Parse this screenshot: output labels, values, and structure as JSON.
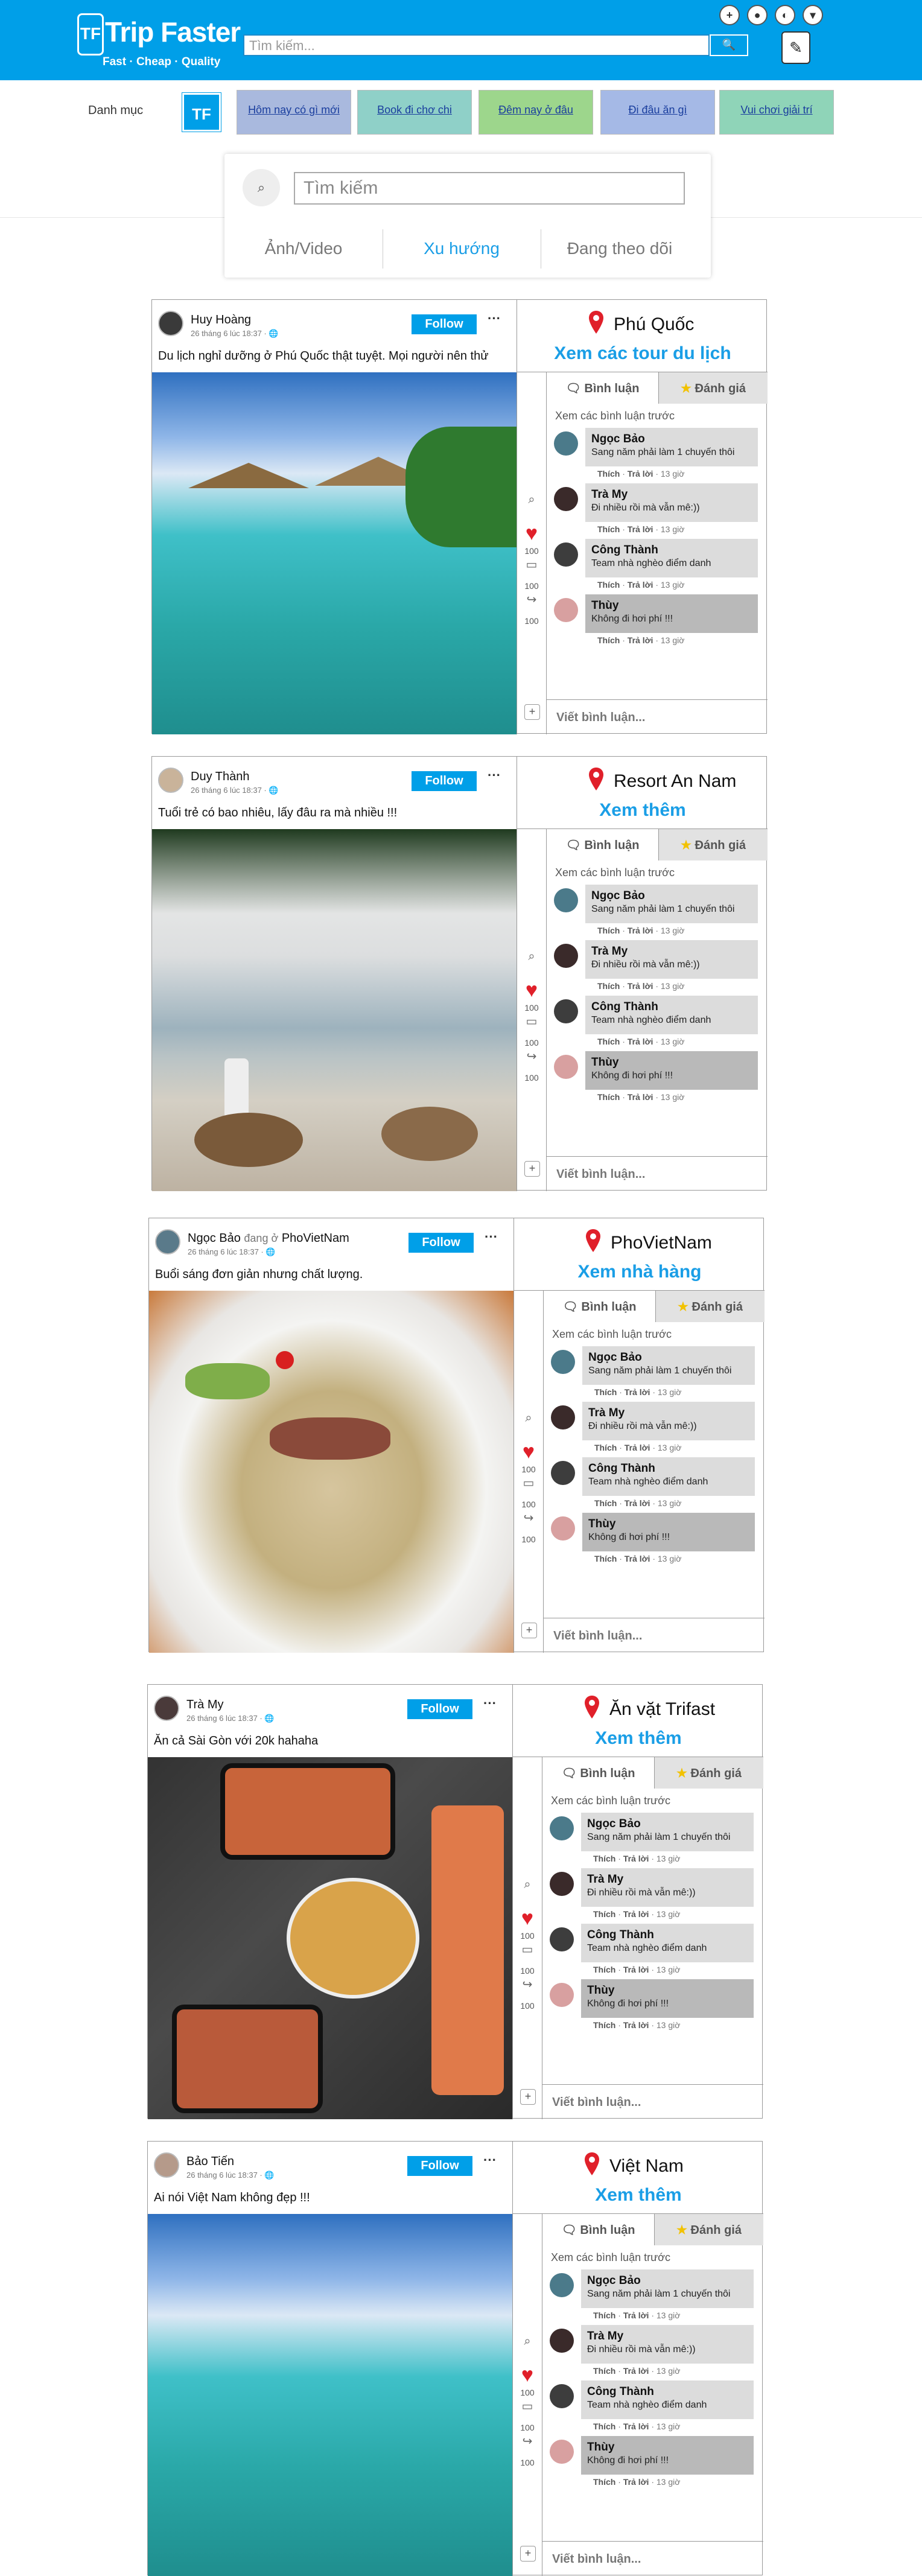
{
  "header": {
    "logo_mark": "TF",
    "title": "Trip Faster",
    "subtitle": "Fast · Cheap · Quality",
    "search_placeholder": "Tìm kiếm...",
    "search_button": "🔍",
    "icons": [
      "plus-icon",
      "bookmark-icon",
      "globe-icon",
      "chevron-down-icon"
    ],
    "bell_icon": "✎"
  },
  "categories": {
    "label": "Danh mục",
    "logo": "TF",
    "items": [
      {
        "label": "Hôm nay có gì mới",
        "color": "#a9b9de"
      },
      {
        "label": "Book đi chơ chi",
        "color": "#8fd0c8"
      },
      {
        "label": "Đêm nay ở đâu",
        "color": "#9dd68c"
      },
      {
        "label": "Đi đâu ăn gì",
        "color": "#a5b9e6"
      },
      {
        "label": "Vui chơi giải trí",
        "color": "#8fd4b8"
      }
    ]
  },
  "search": {
    "placeholder": "Tìm kiếm",
    "tabs": [
      "Ảnh/Video",
      "Xu hướng",
      "Đang theo dõi"
    ]
  },
  "posts": [
    {
      "user": "Huy Hoàng",
      "at": "",
      "at_place": "",
      "time": "26 tháng 6 lúc 18:37 · 🌐",
      "follow": "Follow",
      "more": "···",
      "caption": "Du lịch nghỉ dưỡng ở Phú Quốc thật tuyệt. Mọi người nên thử",
      "place": "Phú Quốc",
      "place_link": "Xem các tour du lịch",
      "likes": "100",
      "comments_count": "100",
      "shares": "100"
    },
    {
      "user": "Duy Thành",
      "at": "",
      "at_place": "",
      "time": "26 tháng 6 lúc 18:37 · 🌐",
      "follow": "Follow",
      "more": "···",
      "caption": "Tuổi trẻ có bao nhiêu, lấy đâu ra mà nhiều !!!",
      "place": "Resort An Nam",
      "place_link": "Xem thêm",
      "likes": "100",
      "comments_count": "100",
      "shares": "100"
    },
    {
      "user": "Ngọc Bảo",
      "at": "đang ở",
      "at_place": "PhoVietNam",
      "time": "26 tháng 6 lúc 18:37 · 🌐",
      "follow": "Follow",
      "more": "···",
      "caption": "Buổi sáng đơn giản nhưng chất lượng.",
      "place": "PhoVietNam",
      "place_link": "Xem nhà hàng",
      "likes": "100",
      "comments_count": "100",
      "shares": "100"
    },
    {
      "user": "Trà My",
      "at": "",
      "at_place": "",
      "time": "26 tháng 6 lúc 18:37 · 🌐",
      "follow": "Follow",
      "more": "···",
      "caption": "Ăn cả Sài Gòn với 20k hahaha",
      "place": "Ăn vặt Trifast",
      "place_link": "Xem thêm",
      "likes": "100",
      "comments_count": "100",
      "shares": "100"
    },
    {
      "user": "Bảo Tiến",
      "at": "",
      "at_place": "",
      "time": "26 tháng 6 lúc 18:37 · 🌐",
      "follow": "Follow",
      "more": "···",
      "caption": "Ai nói Việt Nam không đẹp !!!",
      "place": "Việt Nam",
      "place_link": "Xem thêm",
      "likes": "100",
      "comments_count": "100",
      "shares": "100"
    }
  ],
  "comment_panel": {
    "tab_comment": "Bình luận",
    "tab_rate": "Đánh giá",
    "view_previous": "Xem các bình luận trước",
    "write_placeholder": "Viết bình luận...",
    "like_label": "Thích",
    "reply_label": "Trả lời",
    "time_ago": "13 giờ",
    "comments": [
      {
        "name": "Ngọc Bảo",
        "text": "Sang năm phải làm 1 chuyến thôi"
      },
      {
        "name": "Trà My",
        "text": "Đi nhiều rồi mà vẫn mê:))"
      },
      {
        "name": "Công Thành",
        "text": "Team nhà nghèo điểm danh"
      },
      {
        "name": "Thùy",
        "text": "Không đi hơi phí !!!"
      }
    ]
  }
}
